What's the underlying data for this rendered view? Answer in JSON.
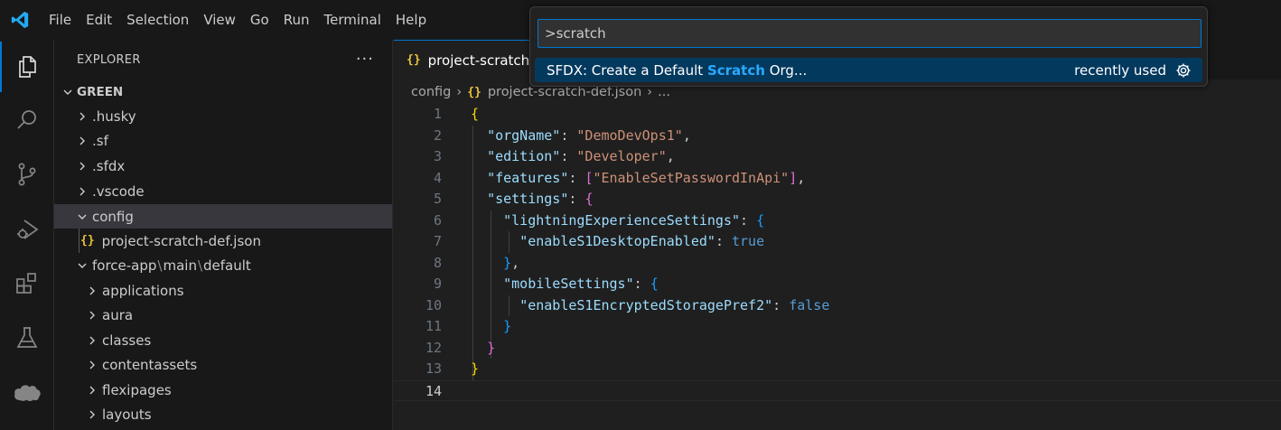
{
  "menu": [
    "File",
    "Edit",
    "Selection",
    "View",
    "Go",
    "Run",
    "Terminal",
    "Help"
  ],
  "explorer": {
    "title": "EXPLORER",
    "more": "···",
    "root": "GREEN",
    "items": [
      {
        "label": ".husky"
      },
      {
        "label": ".sf"
      },
      {
        "label": ".sfdx"
      },
      {
        "label": ".vscode"
      },
      {
        "label": "config"
      },
      {
        "label": "project-scratch-def.json"
      },
      {
        "path": [
          "force-app",
          "main",
          "default"
        ]
      },
      {
        "label": "applications"
      },
      {
        "label": "aura"
      },
      {
        "label": "classes"
      },
      {
        "label": "contentassets"
      },
      {
        "label": "flexipages"
      },
      {
        "label": "layouts"
      }
    ]
  },
  "editor": {
    "tab_label": "project-scratch-",
    "breadcrumb": [
      "config",
      "project-scratch-def.json",
      "..."
    ],
    "line_numbers": [
      "1",
      "2",
      "3",
      "4",
      "5",
      "6",
      "7",
      "8",
      "9",
      "10",
      "11",
      "12",
      "13",
      "14"
    ],
    "code": {
      "k_orgName": "\"orgName\"",
      "v_orgName": "\"DemoDevOps1\"",
      "k_edition": "\"edition\"",
      "v_edition": "\"Developer\"",
      "k_features": "\"features\"",
      "v_feature": "\"EnableSetPasswordInApi\"",
      "k_settings": "\"settings\"",
      "k_les": "\"lightningExperienceSettings\"",
      "k_desktop": "\"enableS1DesktopEnabled\"",
      "v_true": "true",
      "k_mobile": "\"mobileSettings\"",
      "k_encrypted": "\"enableS1EncryptedStoragePref2\"",
      "v_false": "false"
    }
  },
  "palette": {
    "input_value": ">scratch",
    "item_prefix": "SFDX: Create a Default ",
    "item_highlight": "Scratch",
    "item_suffix": " Org...",
    "item_detail": "recently used"
  },
  "colors": {
    "accent": "#0078d4",
    "string": "#ce9178",
    "key": "#9cdcfe",
    "keyword": "#569cd6"
  }
}
